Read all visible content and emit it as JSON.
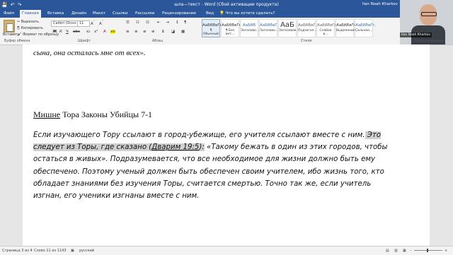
{
  "titlebar": {
    "title": "шла—текст - Word (Сбой активации продукта)",
    "account": "Ilan Noah Kharkov",
    "save_icon": "save-icon",
    "undo_icon": "undo-icon",
    "redo_icon": "redo-icon"
  },
  "tabs": [
    "Файл",
    "Главная",
    "Вставка",
    "Дизайн",
    "Макет",
    "Ссылки",
    "Рассылки",
    "Рецензирование",
    "Вид"
  ],
  "search_prompt": "Что вы хотите сделать?",
  "ribbon": {
    "paste_label": "Вставить",
    "cut_label": "Вырезать",
    "copy_label": "Копировать",
    "format_painter_label": "Формат по образцу",
    "clipboard_group": "Буфер обмена",
    "font_name": "Calibri (Осно",
    "font_size": "11",
    "font_group": "Шрифт",
    "paragraph_group": "Абзац",
    "styles_group": "Стили",
    "editing_group": "Редактирование",
    "styles": [
      {
        "preview": "АаБбВвГг,",
        "name": "¶ Обычный"
      },
      {
        "preview": "АаБбВвГг,",
        "name": "¶ Без инт..."
      },
      {
        "preview": "АаБбВ",
        "name": "Заголово..."
      },
      {
        "preview": "АаБбВвГ",
        "name": "Заголово..."
      },
      {
        "preview": "АаБ",
        "name": "Заголовок"
      },
      {
        "preview": "АаБбВвГ",
        "name": "Подзагол..."
      },
      {
        "preview": "АаБбВвГг,",
        "name": "Слабое в..."
      },
      {
        "preview": "АаБбВвГг,",
        "name": "Выделение"
      },
      {
        "preview": "АаБбВвГг,",
        "name": "Сильное..."
      }
    ]
  },
  "document": {
    "top_fragment": "сына, она осталась мне от всех».",
    "heading_underlined": "Мишне",
    "heading_rest": " Тора Законы Убийцы 7-1",
    "p1_before": "Если изучающего Тору ссылают в город-убежище, его учителя ссылают вместе с ним.",
    "p1_hl": " Это следует из Торы, где сказано (",
    "p1_hl_ul": "Дварим 19:5",
    "p1_hl_end": "):",
    "p1_after": " «Такому бежать в один из этих городов, чтобы остаться в живых». Подразумевается, что все необходимое для жизни должно быть ему обеспечено. Поэтому ученый должен быть обеспечен своим учителем, ибо жизнь того, кто обладает знаниями без изучения Торы, считается смертью. Точно так же, если учитель изгнан, его ученики изгнаны вместе с ним."
  },
  "status": {
    "page": "Страница 3 из 4",
    "words": "Слово 11 из 1143",
    "language": "русский"
  },
  "colors": {
    "accent": "#2b579a",
    "highlight": "#d0d0d0"
  }
}
